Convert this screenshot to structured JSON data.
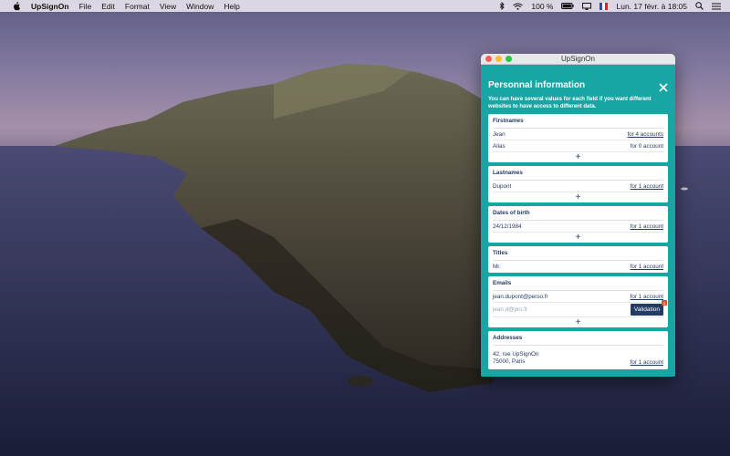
{
  "menubar": {
    "app_name": "UpSignOn",
    "items": [
      "File",
      "Edit",
      "Format",
      "View",
      "Window",
      "Help"
    ],
    "battery": "100 %",
    "clock": "Lun. 17 févr. à 18:05"
  },
  "window": {
    "title": "UpSignOn",
    "heading": "Personnal information",
    "subtext": "You can have several values for each field if you want different websites to have access to different data.",
    "sections": {
      "firstnames": {
        "title": "Firstnames",
        "rows": [
          {
            "value": "Jean",
            "accounts": "for 4 accounts"
          },
          {
            "value": "Alias",
            "accounts": "for 0 account"
          }
        ],
        "add": "+"
      },
      "lastnames": {
        "title": "Lastnames",
        "rows": [
          {
            "value": "Dupont",
            "accounts": "for 1 account"
          }
        ],
        "add": "+"
      },
      "dates_of_birth": {
        "title": "Dates of birth",
        "rows": [
          {
            "value": "24/12/1984",
            "accounts": "for 1 account"
          }
        ],
        "add": "+"
      },
      "titles": {
        "title": "Titles",
        "rows": [
          {
            "value": "Mr.",
            "accounts": "for 1 account"
          }
        ]
      },
      "emails": {
        "title": "Emails",
        "rows": [
          {
            "value": "jean.dupont@perso.fr",
            "accounts": "for 1 account"
          }
        ],
        "pending": {
          "value": "jean.d@pro.fr",
          "button": "Validation",
          "badge": "1"
        },
        "add": "+"
      },
      "addresses": {
        "title": "Addresses",
        "line1": "42, rue UpSignOn",
        "line2": "75000, Paris",
        "accounts": "for 1 account"
      }
    }
  },
  "colors": {
    "window_bg": "#17a6a3",
    "text_navy": "#243b63",
    "badge_red": "#e14f2e"
  }
}
